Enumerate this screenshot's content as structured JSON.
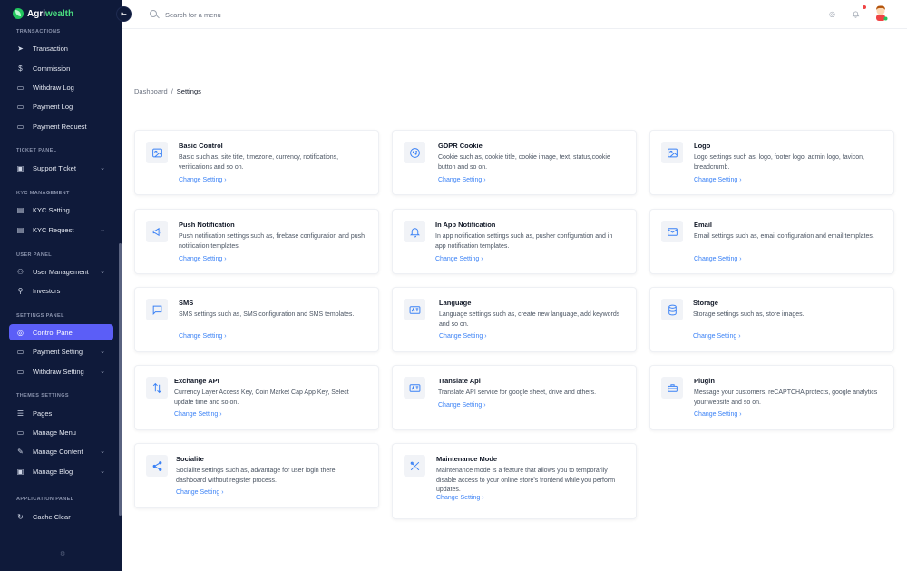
{
  "brand": {
    "name_a": "Agri",
    "name_b": "wealth"
  },
  "header": {
    "search_placeholder": "Search for a menu"
  },
  "sidebar": {
    "sections": [
      {
        "label": "TRANSACTIONS"
      },
      {
        "label": "TICKET PANEL"
      },
      {
        "label": "KYC MANAGEMENT"
      },
      {
        "label": "USER PANEL"
      },
      {
        "label": "SETTINGS PANEL"
      },
      {
        "label": "THEMES SETTINGS"
      },
      {
        "label": "APPLICATION PANEL"
      }
    ],
    "items": [
      {
        "label": "Transaction",
        "icon": "send-icon"
      },
      {
        "label": "Commission",
        "icon": "dollar-icon"
      },
      {
        "label": "Withdraw Log",
        "icon": "folder-icon"
      },
      {
        "label": "Payment Log",
        "icon": "wallet-icon"
      },
      {
        "label": "Payment Request",
        "icon": "card-icon"
      },
      {
        "label": "Support Ticket",
        "icon": "ticket-icon"
      },
      {
        "label": "KYC Setting",
        "icon": "id-card-icon"
      },
      {
        "label": "KYC Request",
        "icon": "check-card-icon"
      },
      {
        "label": "User Management",
        "icon": "users-icon"
      },
      {
        "label": "Investors",
        "icon": "user-icon"
      },
      {
        "label": "Control Panel",
        "icon": "settings-icon"
      },
      {
        "label": "Payment Setting",
        "icon": "wallet-icon"
      },
      {
        "label": "Withdraw Setting",
        "icon": "folder-icon"
      },
      {
        "label": "Pages",
        "icon": "list-icon"
      },
      {
        "label": "Manage Menu",
        "icon": "folder-icon"
      },
      {
        "label": "Manage Content",
        "icon": "pen-icon"
      },
      {
        "label": "Manage Blog",
        "icon": "blog-icon"
      },
      {
        "label": "Cache Clear",
        "icon": "refresh-icon"
      }
    ]
  },
  "breadcrumb": {
    "home": "Dashboard",
    "sep": "/",
    "current": "Settings"
  },
  "link_label": "Change Setting",
  "cards": [
    {
      "title": "Basic Control",
      "desc": "Basic such as, site title, timezone, currency, notifications, verifications and so on.",
      "icon": "image-icon"
    },
    {
      "title": "GDPR Cookie",
      "desc": "Cookie such as, cookie title, cookie image, text, status,cookie button and so on.",
      "icon": "cookie-icon"
    },
    {
      "title": "Logo",
      "desc": "Logo settings such as, logo, footer logo, admin logo, favicon, breadcrumb.",
      "icon": "image-icon"
    },
    {
      "title": "Push Notification",
      "desc": "Push notification settings such as, firebase configuration and push notification templates.",
      "icon": "megaphone-icon"
    },
    {
      "title": "In App Notification",
      "desc": "In app notification settings such as, pusher configuration and in app notification templates.",
      "icon": "bell-icon"
    },
    {
      "title": "Email",
      "desc": "Email settings such as, email configuration and email templates.",
      "icon": "mail-icon"
    },
    {
      "title": "SMS",
      "desc": "SMS settings such as, SMS configuration and SMS templates.",
      "icon": "chat-icon"
    },
    {
      "title": "Language",
      "desc": "Language settings such as, create new language, add keywords and so on.",
      "icon": "translate-icon"
    },
    {
      "title": "Storage",
      "desc": "Storage settings such as, store images.",
      "icon": "database-icon"
    },
    {
      "title": "Exchange API",
      "desc": "Currency Layer Access Key, Coin Market Cap App Key, Select update time and so on.",
      "icon": "exchange-icon"
    },
    {
      "title": "Translate Api",
      "desc": "Translate API service for google sheet, drive and others.",
      "icon": "translate-icon"
    },
    {
      "title": "Plugin",
      "desc": "Message your customers, reCAPTCHA protects, google analytics your website and so on.",
      "icon": "plugin-icon"
    },
    {
      "title": "Socialite",
      "desc": "Socialite settings such as, advantage for user login there dashboard without register process.",
      "icon": "share-icon"
    },
    {
      "title": "Maintenance Mode",
      "desc": "Maintenance mode is a feature that allows you to temporarily disable access to your online store's frontend while you perform updates.",
      "icon": "tools-icon"
    }
  ]
}
